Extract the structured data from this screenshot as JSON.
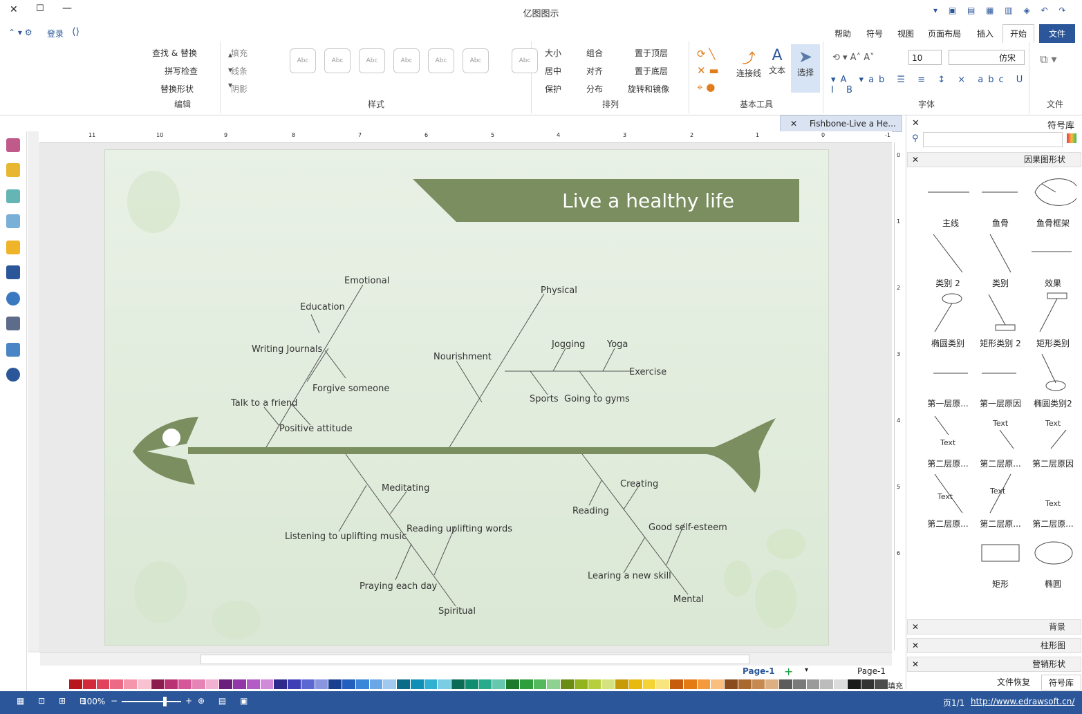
{
  "app": {
    "title": "亿图图示"
  },
  "tabs": [
    {
      "label": "文件",
      "kind": "file"
    },
    {
      "label": "开始",
      "kind": "active"
    },
    {
      "label": "插入",
      "kind": ""
    },
    {
      "label": "页面布局",
      "kind": ""
    },
    {
      "label": "视图",
      "kind": ""
    },
    {
      "label": "符号",
      "kind": ""
    },
    {
      "label": "帮助",
      "kind": ""
    }
  ],
  "quick_access": {
    "login": "登录"
  },
  "ribbon": {
    "file_group": {
      "label": "文件"
    },
    "font_group": {
      "label": "字体",
      "font_name": "仿宋",
      "font_size": "10"
    },
    "tools_group": {
      "label": "基本工具",
      "select": "选择",
      "text": "文本",
      "connector": "连接线"
    },
    "arrange_group": {
      "label": "排列",
      "items": [
        "置于顶层",
        "置于底层",
        "旋转和镜像",
        "组合",
        "对齐",
        "分布",
        "大小",
        "居中",
        "保护"
      ]
    },
    "style_group": {
      "label": "样式",
      "box_text": "Abc",
      "fill": "填充",
      "line": "线条",
      "shadow": "阴影"
    },
    "edit_group": {
      "label": "编辑",
      "find_replace": "查找 & 替换",
      "spell_check": "拼写检查",
      "replace_shape": "替换形状"
    }
  },
  "document_tab": {
    "label": "Fishbone-Live a He..."
  },
  "ruler": {
    "h_ticks": [
      "-1",
      "0",
      "1",
      "2",
      "3",
      "4",
      "5",
      "6",
      "7",
      "8",
      "9",
      "10",
      "11"
    ],
    "v_ticks": [
      "0",
      "1",
      "2",
      "3",
      "4",
      "5",
      "6"
    ]
  },
  "diagram": {
    "title": "Live a healthy life",
    "labels": {
      "emotional": "Emotional",
      "education": "Education",
      "writing_journals": "Writing Journals",
      "forgive_someone": "Forgive someone",
      "talk_to_a_friend": "Talk to a friend",
      "positive_attitude": "Positive attitude",
      "physical": "Physical",
      "nourishment": "Nourishment",
      "jogging": "Jogging",
      "yoga": "Yoga",
      "exercise": "Exercise",
      "sports": "Sports",
      "going_to_gyms": "Going to gyms",
      "meditating": "Meditating",
      "reading_uplifting_words": "Reading uplifting words",
      "listening_to_uplifting_music": "Listening to uplifting music",
      "praying_each_day": "Praying each day",
      "spiritual": "Spiritual",
      "creating": "Creating",
      "reading": "Reading",
      "good_self_esteem": "Good self-esteem",
      "learing_a_new_skill": "Learing a new skill",
      "mental": "Mental"
    }
  },
  "symbol_library": {
    "title": "符号库",
    "category": "因果图形状",
    "shapes": [
      [
        "鱼骨框架",
        "鱼骨",
        "主线"
      ],
      [
        "效果",
        "类别",
        "类别 2"
      ],
      [
        "矩形类别",
        "矩形类别 2",
        "椭圆类别"
      ],
      [
        "椭圆类别2",
        "第一层原因",
        "第一层原..."
      ],
      [
        "第二层原因",
        "第二层原...",
        "第二层原..."
      ],
      [
        "第二层原...",
        "第二层原...",
        "第二层原..."
      ],
      [
        "椭圆",
        "矩形",
        ""
      ]
    ],
    "shape_text": "Text",
    "collapsed": [
      "背景",
      "柱形图",
      "营销形状"
    ],
    "bottom_tabs": [
      "符号库",
      "文件恢复"
    ]
  },
  "page_tabs": {
    "page": "Page-1",
    "current": "Page-1"
  },
  "palette_label": "填充",
  "status": {
    "url": "http://www.edrawsoft.cn/",
    "pages": "页1/1",
    "zoom": "100%"
  },
  "colors": {
    "fish": "#7a8e60",
    "title_banner": "#7a8e60",
    "accent": "#2b579a"
  }
}
